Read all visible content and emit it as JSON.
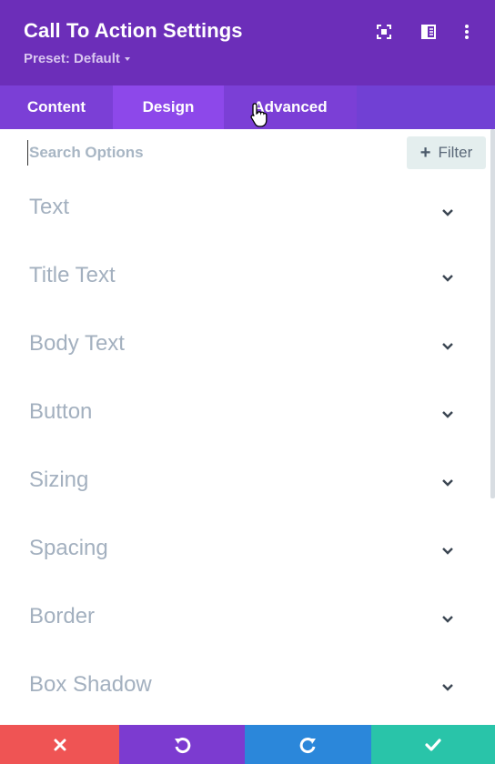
{
  "header": {
    "title": "Call To Action Settings",
    "preset": "Preset: Default",
    "icons": [
      "expand-icon",
      "split-view-icon",
      "more-vertical-icon"
    ]
  },
  "tabs": [
    {
      "label": "Content"
    },
    {
      "label": "Design"
    },
    {
      "label": "Advanced"
    }
  ],
  "active_tab": "Design",
  "search": {
    "placeholder": "Search Options",
    "value": ""
  },
  "filter": {
    "label": "Filter"
  },
  "toggles": [
    {
      "label": "Text"
    },
    {
      "label": "Title Text"
    },
    {
      "label": "Body Text"
    },
    {
      "label": "Button"
    },
    {
      "label": "Sizing"
    },
    {
      "label": "Spacing"
    },
    {
      "label": "Border"
    },
    {
      "label": "Box Shadow"
    }
  ],
  "footer": {
    "buttons": [
      "close-icon",
      "undo-icon",
      "redo-icon",
      "check-icon"
    ]
  },
  "colors": {
    "header_bg": "#6c2eb9",
    "tabs_bg": "#7b3fd6",
    "active_tab_bg": "#8d48ea",
    "discard": "#ef5454",
    "undo": "#7c3bd0",
    "redo": "#2b87da",
    "save": "#29c4a9"
  }
}
